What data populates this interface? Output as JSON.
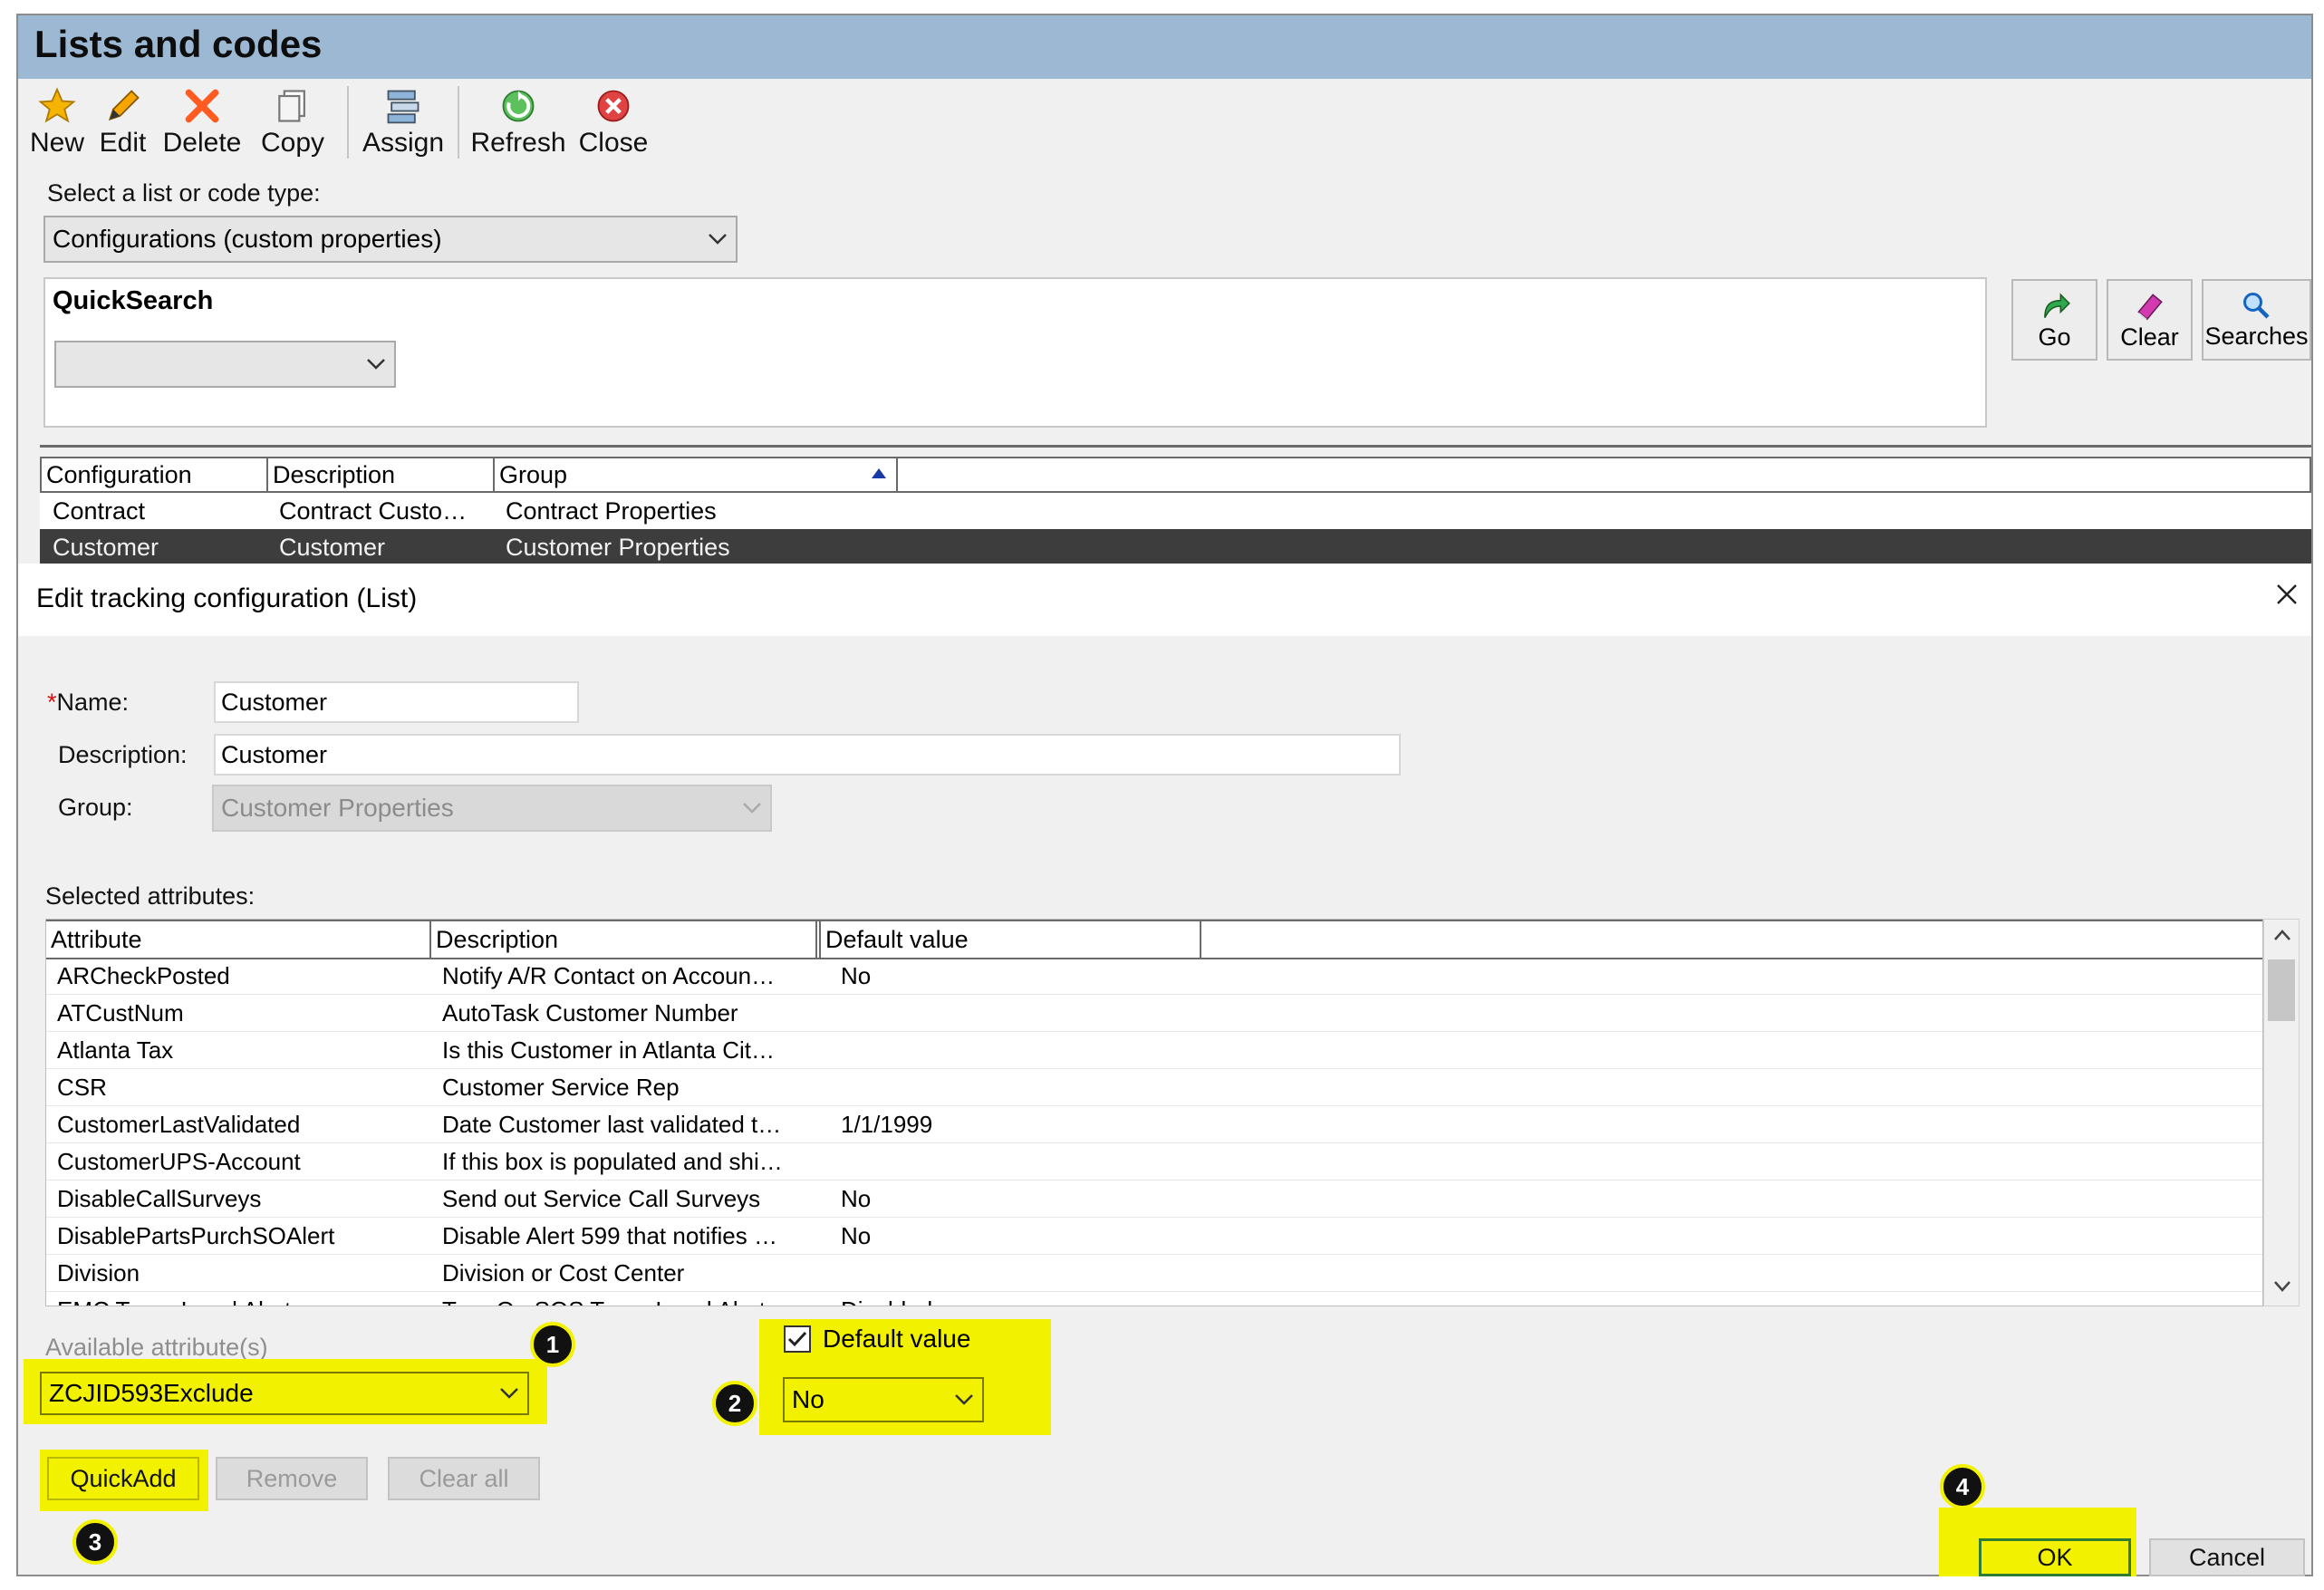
{
  "window": {
    "title": "Lists and codes"
  },
  "toolbar": {
    "new": "New",
    "edit": "Edit",
    "delete": "Delete",
    "copy": "Copy",
    "assign": "Assign",
    "refresh": "Refresh",
    "close": "Close"
  },
  "selector": {
    "label": "Select a list or code type:",
    "value": "Configurations (custom properties)"
  },
  "quicksearch": {
    "title": "QuickSearch",
    "value": ""
  },
  "search_buttons": {
    "go": "Go",
    "clear": "Clear",
    "searches": "Searches"
  },
  "config_grid": {
    "columns": [
      "Configuration",
      "Description",
      "Group"
    ],
    "rows": [
      [
        "Contract",
        "Contract Custo…",
        "Contract Properties"
      ],
      [
        "Customer",
        "Customer",
        "Customer Properties"
      ]
    ]
  },
  "dialog": {
    "title": "Edit tracking configuration (List)",
    "required_mark": "*",
    "name_label": "Name:",
    "name_value": "Customer",
    "description_label": "Description:",
    "description_value": "Customer",
    "group_label": "Group:",
    "group_value": "Customer Properties",
    "selected_attributes_label": "Selected attributes:",
    "attr_columns": [
      "Attribute",
      "Description",
      "Default value"
    ],
    "attributes": [
      [
        "ARCheckPosted",
        "Notify A/R Contact on Accoun…",
        "No"
      ],
      [
        "ATCustNum",
        "AutoTask Customer Number",
        ""
      ],
      [
        "Atlanta Tax",
        "Is this Customer in Atlanta Cit…",
        ""
      ],
      [
        "CSR",
        "Customer Service Rep",
        ""
      ],
      [
        "CustomerLastValidated",
        "Date Customer last validated t…",
        "1/1/1999"
      ],
      [
        "CustomerUPS-Account",
        "If this box is populated and shi…",
        ""
      ],
      [
        "DisableCallSurveys",
        "Send out Service Call Surveys",
        "No"
      ],
      [
        "DisablePartsPurchSOAlert",
        "Disable Alert 599 that notifies …",
        "No"
      ],
      [
        "Division",
        "Division or Cost Center",
        ""
      ],
      [
        "EMC Toner Level Alert",
        "Turn On SOS Toner Level Alert",
        "Disabled"
      ]
    ],
    "available_label": "Available attribute(s)",
    "available_value": "ZCJID593Exclude",
    "default_checkbox_label": "Default value",
    "default_value": "No",
    "quickadd": "QuickAdd",
    "remove": "Remove",
    "clear_all": "Clear all",
    "ok": "OK",
    "cancel": "Cancel"
  },
  "callouts": [
    "1",
    "2",
    "3",
    "4"
  ],
  "colors": {
    "title_bar": "#9db8d3",
    "selected_row": "#3d3d3d",
    "highlight": "#f2f200"
  }
}
